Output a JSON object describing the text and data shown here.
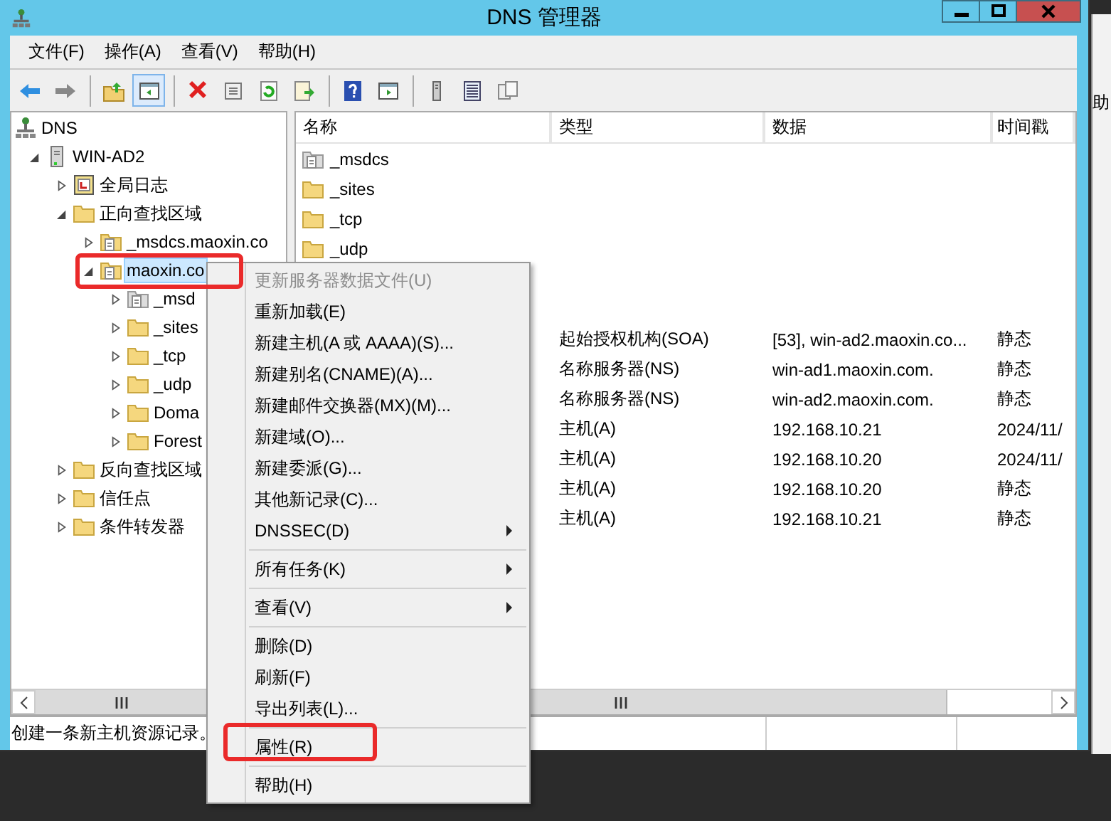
{
  "window": {
    "title": "DNS 管理器"
  },
  "menubar": [
    {
      "label": "文件(F)"
    },
    {
      "label": "操作(A)"
    },
    {
      "label": "查看(V)"
    },
    {
      "label": "帮助(H)"
    }
  ],
  "toolbar": [
    {
      "kind": "back",
      "disabled": false,
      "pressed": false
    },
    {
      "kind": "forward",
      "disabled": true,
      "pressed": false
    },
    {
      "kind": "separator"
    },
    {
      "kind": "up",
      "disabled": false,
      "pressed": false
    },
    {
      "kind": "console-tree",
      "disabled": false,
      "pressed": true
    },
    {
      "kind": "separator"
    },
    {
      "kind": "delete",
      "disabled": false,
      "pressed": false
    },
    {
      "kind": "properties",
      "disabled": false,
      "pressed": false
    },
    {
      "kind": "refresh",
      "disabled": false,
      "pressed": false
    },
    {
      "kind": "export",
      "disabled": false,
      "pressed": false
    },
    {
      "kind": "separator"
    },
    {
      "kind": "help",
      "disabled": false,
      "pressed": false
    },
    {
      "kind": "action-pane",
      "disabled": false,
      "pressed": false
    },
    {
      "kind": "separator"
    },
    {
      "kind": "server",
      "disabled": false,
      "pressed": false
    },
    {
      "kind": "list",
      "disabled": false,
      "pressed": false
    },
    {
      "kind": "copy",
      "disabled": false,
      "pressed": false
    }
  ],
  "tree": [
    {
      "label": "DNS",
      "kind": "dns",
      "selected": false,
      "children": [
        {
          "label": "WIN-AD2",
          "kind": "server",
          "expanded": true,
          "selected": false,
          "children": [
            {
              "label": "全局日志",
              "kind": "log",
              "expanded": false,
              "selected": false
            },
            {
              "label": "正向查找区域",
              "kind": "folder",
              "expanded": true,
              "selected": false,
              "children": [
                {
                  "label": "_msdcs.maoxin.co",
                  "kind": "zone",
                  "expanded": false,
                  "selected": false
                },
                {
                  "label": "maoxin.co",
                  "kind": "zone",
                  "expanded": true,
                  "selected": true,
                  "children": [
                    {
                      "label": "_msd",
                      "kind": "zone-gray",
                      "expanded": false,
                      "selected": false
                    },
                    {
                      "label": "_sites",
                      "kind": "folder",
                      "expanded": false,
                      "selected": false
                    },
                    {
                      "label": "_tcp",
                      "kind": "folder",
                      "expanded": false,
                      "selected": false
                    },
                    {
                      "label": "_udp",
                      "kind": "folder",
                      "expanded": false,
                      "selected": false
                    },
                    {
                      "label": "Doma",
                      "kind": "folder",
                      "expanded": false,
                      "selected": false
                    },
                    {
                      "label": "Forest",
                      "kind": "folder",
                      "expanded": false,
                      "selected": false
                    }
                  ]
                }
              ]
            },
            {
              "label": "反向查找区域",
              "kind": "folder",
              "expanded": false,
              "selected": false
            },
            {
              "label": "信任点",
              "kind": "folder",
              "expanded": false,
              "selected": false
            },
            {
              "label": "条件转发器",
              "kind": "folder",
              "expanded": false,
              "selected": false
            }
          ]
        }
      ]
    }
  ],
  "list": {
    "columns": [
      "名称",
      "类型",
      "数据",
      "时间戳"
    ],
    "folders": [
      {
        "name": "_msdcs",
        "kind": "zone-gray"
      },
      {
        "name": "_sites",
        "kind": "folder"
      },
      {
        "name": "_tcp",
        "kind": "folder"
      },
      {
        "name": "_udp",
        "kind": "folder"
      }
    ],
    "records": [
      {
        "type": "起始授权机构(SOA)",
        "data": "[53], win-ad2.maoxin.co...",
        "timestamp": "静态"
      },
      {
        "type": "名称服务器(NS)",
        "data": "win-ad1.maoxin.com.",
        "timestamp": "静态"
      },
      {
        "type": "名称服务器(NS)",
        "data": "win-ad2.maoxin.com.",
        "timestamp": "静态"
      },
      {
        "type": "主机(A)",
        "data": "192.168.10.21",
        "timestamp": "2024/11/"
      },
      {
        "type": "主机(A)",
        "data": "192.168.10.20",
        "timestamp": "2024/11/"
      },
      {
        "type": "主机(A)",
        "data": "192.168.10.20",
        "timestamp": "静态"
      },
      {
        "type": "主机(A)",
        "data": "192.168.10.21",
        "timestamp": "静态"
      }
    ]
  },
  "status_bar": {
    "text": "创建一条新主机资源记录。"
  },
  "context_menu": {
    "groups": [
      [
        {
          "label": "更新服务器数据文件(U)",
          "disabled": true,
          "submenu": false
        },
        {
          "label": "重新加载(E)",
          "disabled": false,
          "submenu": false
        },
        {
          "label": "新建主机(A 或 AAAA)(S)...",
          "disabled": false,
          "submenu": false
        },
        {
          "label": "新建别名(CNAME)(A)...",
          "disabled": false,
          "submenu": false
        },
        {
          "label": "新建邮件交换器(MX)(M)...",
          "disabled": false,
          "submenu": false
        },
        {
          "label": "新建域(O)...",
          "disabled": false,
          "submenu": false
        },
        {
          "label": "新建委派(G)...",
          "disabled": false,
          "submenu": false
        },
        {
          "label": "其他新记录(C)...",
          "disabled": false,
          "submenu": false
        },
        {
          "label": "DNSSEC(D)",
          "disabled": false,
          "submenu": true
        }
      ],
      [
        {
          "label": "所有任务(K)",
          "disabled": false,
          "submenu": true
        }
      ],
      [
        {
          "label": "查看(V)",
          "disabled": false,
          "submenu": true
        }
      ],
      [
        {
          "label": "删除(D)",
          "disabled": false,
          "submenu": false
        },
        {
          "label": "刷新(F)",
          "disabled": false,
          "submenu": false
        },
        {
          "label": "导出列表(L)...",
          "disabled": false,
          "submenu": false
        }
      ],
      [
        {
          "label": "属性(R)",
          "disabled": false,
          "submenu": false
        }
      ],
      [
        {
          "label": "帮助(H)",
          "disabled": false,
          "submenu": false
        }
      ]
    ]
  },
  "background_window": {
    "text": "助"
  }
}
